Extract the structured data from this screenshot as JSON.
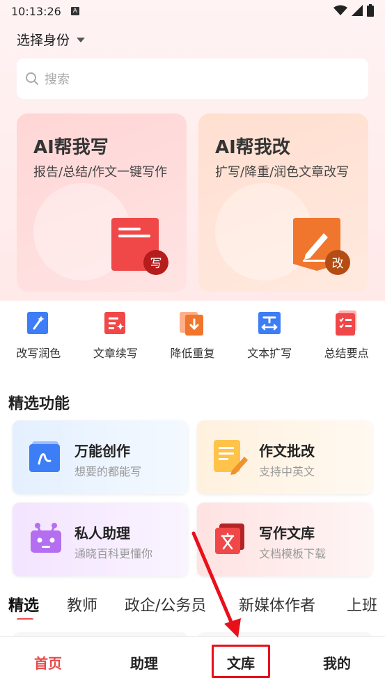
{
  "status_bar": {
    "time": "10:13:26",
    "a_badge": "A"
  },
  "identity": {
    "label": "选择身份"
  },
  "search": {
    "placeholder": "搜索"
  },
  "big_cards": [
    {
      "title": "AI帮我写",
      "desc": "报告/总结/作文一键写作",
      "badge": "写"
    },
    {
      "title": "AI帮我改",
      "desc": "扩写/降重/润色文章改写",
      "badge": "改"
    }
  ],
  "quick_tools": [
    {
      "label": "改写润色",
      "icon": "magic-wand-icon"
    },
    {
      "label": "文章续写",
      "icon": "document-sparkle-icon"
    },
    {
      "label": "降低重复",
      "icon": "down-arrow-doc-icon"
    },
    {
      "label": "文本扩写",
      "icon": "text-expand-icon"
    },
    {
      "label": "总结要点",
      "icon": "checklist-icon"
    }
  ],
  "featured": {
    "title": "精选功能",
    "items": [
      {
        "title": "万能创作",
        "subtitle": "想要的都能写"
      },
      {
        "title": "作文批改",
        "subtitle": "支持中英文"
      },
      {
        "title": "私人助理",
        "subtitle": "通晓百科更懂你"
      },
      {
        "title": "写作文库",
        "subtitle": "文档模板下载"
      }
    ]
  },
  "category_tabs": [
    "精选",
    "教师",
    "政企/公务员",
    "新媒体作者",
    "上班"
  ],
  "bottom_nav": [
    "首页",
    "助理",
    "文库",
    "我的"
  ],
  "colors": {
    "accent": "#e84a4a",
    "highlight": "#e8101a"
  }
}
